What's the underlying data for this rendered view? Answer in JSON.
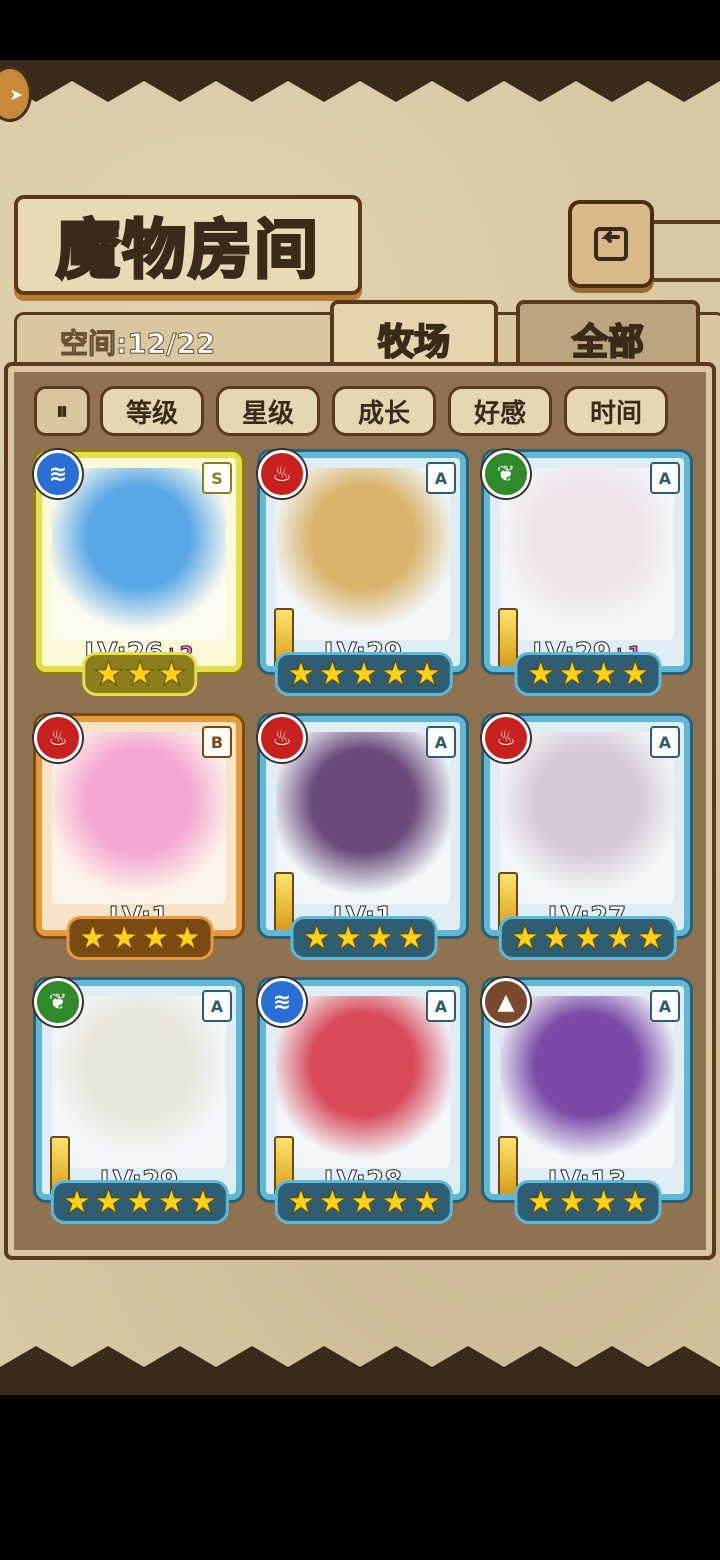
{
  "title": "魔物房间",
  "space": "空间:12/22",
  "tabs": {
    "ranch": "牧场",
    "all": "全部"
  },
  "filters": [
    "等级",
    "星级",
    "成长",
    "好感",
    "时间"
  ],
  "monsters": [
    {
      "element": "water",
      "rank": "S",
      "lv": "LV:26",
      "bonus": "+2",
      "stars": 3,
      "tint": "#5aa7e6"
    },
    {
      "element": "fire",
      "rank": "A",
      "lv": "LV:29",
      "bonus": "",
      "stars": 5,
      "tint": "#d9b36a"
    },
    {
      "element": "grass",
      "rank": "A",
      "lv": "LV:29",
      "bonus": "+1",
      "stars": 4,
      "tint": "#f0e2ea"
    },
    {
      "element": "fire",
      "rank": "B",
      "lv": "LV:1",
      "bonus": "",
      "stars": 4,
      "tint": "#f4a6d2"
    },
    {
      "element": "fire",
      "rank": "A",
      "lv": "LV:1",
      "bonus": "",
      "stars": 4,
      "tint": "#6a4a7a"
    },
    {
      "element": "fire",
      "rank": "A",
      "lv": "LV:27",
      "bonus": "",
      "stars": 5,
      "tint": "#d8c7d6"
    },
    {
      "element": "grass",
      "rank": "A",
      "lv": "LV:29",
      "bonus": "",
      "stars": 5,
      "tint": "#e8e6d8"
    },
    {
      "element": "water",
      "rank": "A",
      "lv": "LV:28",
      "bonus": "",
      "stars": 5,
      "tint": "#d84a5a"
    },
    {
      "element": "earth",
      "rank": "A",
      "lv": "LV:13",
      "bonus": "",
      "stars": 4,
      "tint": "#7a4aa6"
    }
  ]
}
